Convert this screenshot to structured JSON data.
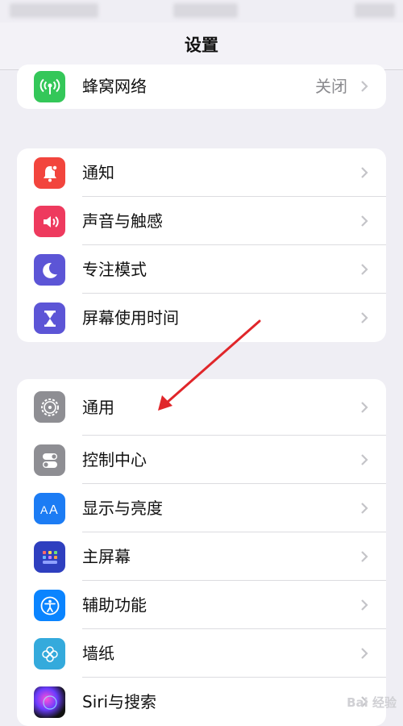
{
  "header": {
    "title": "设置"
  },
  "group_top": [
    {
      "label": "蜂窝网络",
      "value": "关闭",
      "icon": "cellular-icon",
      "color": "#34c759"
    }
  ],
  "group_mid": [
    {
      "label": "通知",
      "icon": "notification-bell-icon",
      "color": "#ff3b30"
    },
    {
      "label": "声音与触感",
      "icon": "speaker-icon",
      "color": "#ff2d55"
    },
    {
      "label": "专注模式",
      "icon": "moon-icon",
      "color": "#5856d6"
    },
    {
      "label": "屏幕使用时间",
      "icon": "hourglass-icon",
      "color": "#5856d6"
    }
  ],
  "group_bottom": [
    {
      "label": "通用",
      "icon": "gear-icon",
      "color": "#8e8e93"
    },
    {
      "label": "控制中心",
      "icon": "toggles-icon",
      "color": "#8e8e93"
    },
    {
      "label": "显示与亮度",
      "icon": "text-size-icon",
      "color": "#1c7cf4"
    },
    {
      "label": "主屏幕",
      "icon": "home-grid-icon",
      "color": "#2e3fbf"
    },
    {
      "label": "辅助功能",
      "icon": "accessibility-icon",
      "color": "#0a84ff"
    },
    {
      "label": "墙纸",
      "icon": "flower-icon",
      "color": "#34aadc"
    },
    {
      "label": "Siri与搜索",
      "icon": "siri-icon",
      "color": "#222222"
    }
  ],
  "watermark": "Bai 经验"
}
